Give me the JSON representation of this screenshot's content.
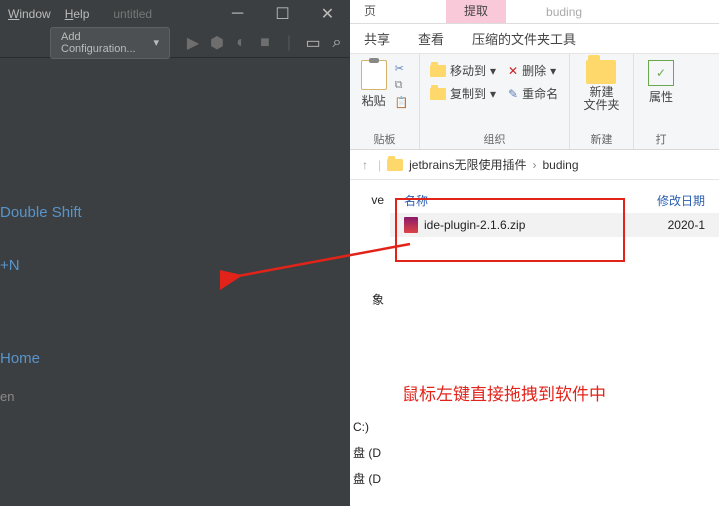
{
  "ide": {
    "menu_window": "Window",
    "menu_help": "Help",
    "title": "untitled",
    "add_config": "Add Configuration...",
    "hints": {
      "double_shift": "Double Shift",
      "ctrl_n": "+N",
      "home": "Home",
      "en": "en"
    }
  },
  "explorer": {
    "tab_left": "页",
    "tab_active": "提取",
    "tab_right": "buding",
    "subtabs": {
      "share": "共享",
      "view": "查看",
      "zip": "压缩的文件夹工具"
    },
    "ribbon": {
      "paste": "粘贴",
      "clipboard": "贴板",
      "move_to": "移动到",
      "copy_to": "复制到",
      "delete": "删除",
      "rename": "重命名",
      "organize": "组织",
      "new_folder": "新建\n文件夹",
      "new": "新建",
      "properties": "属性",
      "open_group": "打"
    },
    "breadcrumb": {
      "up": "↑",
      "folder": "jetbrains无限使用插件",
      "sub": "buding",
      "sep": "›"
    },
    "columns": {
      "name": "名称",
      "date": "修改日期"
    },
    "file": {
      "name": "ide-plugin-2.1.6.zip",
      "date": "2020-1"
    },
    "drives": {
      "c": "C:)",
      "d1": "盘 (D",
      "d2": "盘 (D"
    }
  },
  "strip": {
    "ve": "ve",
    "xiang": "象"
  },
  "annotation": "鼠标左键直接拖拽到软件中"
}
